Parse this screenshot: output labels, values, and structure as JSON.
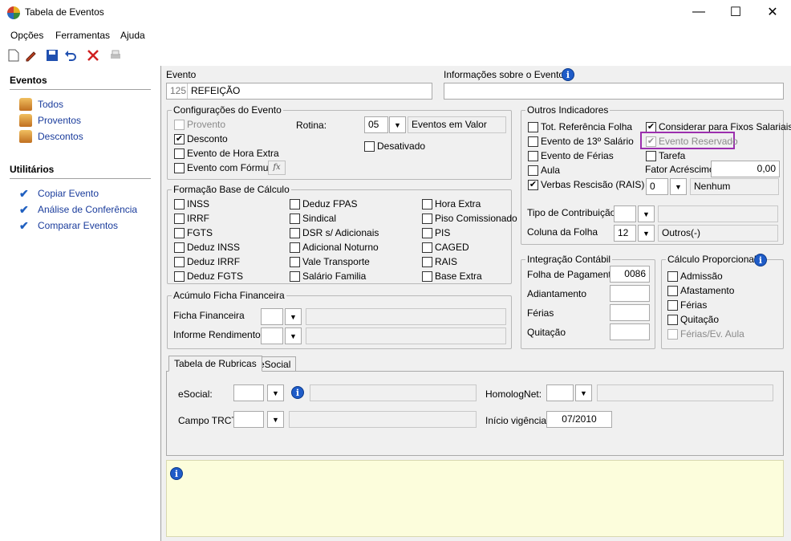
{
  "window": {
    "title": "Tabela de Eventos",
    "minimize": "—",
    "maximize": "☐",
    "close": "✕"
  },
  "menu": [
    "Opções",
    "Ferramentas",
    "Ajuda"
  ],
  "sidebar": {
    "eventos_title": "Eventos",
    "eventos": [
      "Todos",
      "Proventos",
      "Descontos"
    ],
    "utilitarios_title": "Utilitários",
    "utilitarios": [
      "Copiar Evento",
      "Análise de Conferência",
      "Comparar Eventos"
    ]
  },
  "evento": {
    "label": "Evento",
    "codigo": "125",
    "nome": "REFEIÇÃO",
    "info_label": "Informações sobre o Evento",
    "info_value": ""
  },
  "config": {
    "title": "Configurações do Evento",
    "provento": "Provento",
    "desconto": "Desconto",
    "hora_extra": "Evento de Hora Extra",
    "formula": "Evento com Fórmula",
    "formula_btn": "fx",
    "rotina_label": "Rotina:",
    "rotina_code": "05",
    "rotina_desc": "Eventos em Valor",
    "desativado": "Desativado"
  },
  "base": {
    "title": "Formação Base de Cálculo",
    "col1": [
      "INSS",
      "IRRF",
      "FGTS",
      "Deduz INSS",
      "Deduz IRRF",
      "Deduz FGTS"
    ],
    "col2": [
      "Deduz FPAS",
      "Sindical",
      "DSR s/ Adicionais",
      "Adicional Noturno",
      "Vale Transporte",
      "Salário Familia"
    ],
    "col3": [
      "Hora Extra",
      "Piso Comissionado",
      "PIS",
      "CAGED",
      "RAIS",
      "Base Extra"
    ]
  },
  "acumulo": {
    "title": "Acúmulo Ficha Financeira",
    "ficha_label": "Ficha Financeira",
    "informe_label": "Informe Rendimentos"
  },
  "outros": {
    "title": "Outros Indicadores",
    "tot_ref": "Tot. Referência Folha",
    "evt_13": "Evento de 13º Salário",
    "evt_ferias": "Evento de Férias",
    "aula": "Aula",
    "verbas": "Verbas Rescisão (RAIS)",
    "fixos": "Considerar para Fixos Salariais",
    "reservado": "Evento Reservado",
    "tarefa": "Tarefa",
    "fator_label": "Fator Acréscimo",
    "fator_value": "0,00",
    "verbas_code": "0",
    "verbas_desc": "Nenhum",
    "tipo_contrib_label": "Tipo de Contribuição",
    "coluna_label": "Coluna da Folha",
    "coluna_code": "12",
    "coluna_desc": "Outros(-)"
  },
  "integracao": {
    "title": "Integração Contábil",
    "folha_label": "Folha de Pagamento",
    "folha_value": "0086",
    "adiantamento": "Adiantamento",
    "ferias": "Férias",
    "quitacao": "Quitação"
  },
  "proporcional": {
    "title": "Cálculo Proporcional",
    "items": [
      "Admissão",
      "Afastamento",
      "Férias",
      "Quitação",
      "Férias/Ev. Aula"
    ]
  },
  "tabs": {
    "rubricas": "Tabela de Rubricas",
    "esocial": "eSocial"
  },
  "rubricas": {
    "esocial_label": "eSocial:",
    "homolognet_label": "HomologNet:",
    "trct_label": "Campo TRCT:",
    "inicio_label": "Início vigência:",
    "inicio_value": "07/2010"
  }
}
